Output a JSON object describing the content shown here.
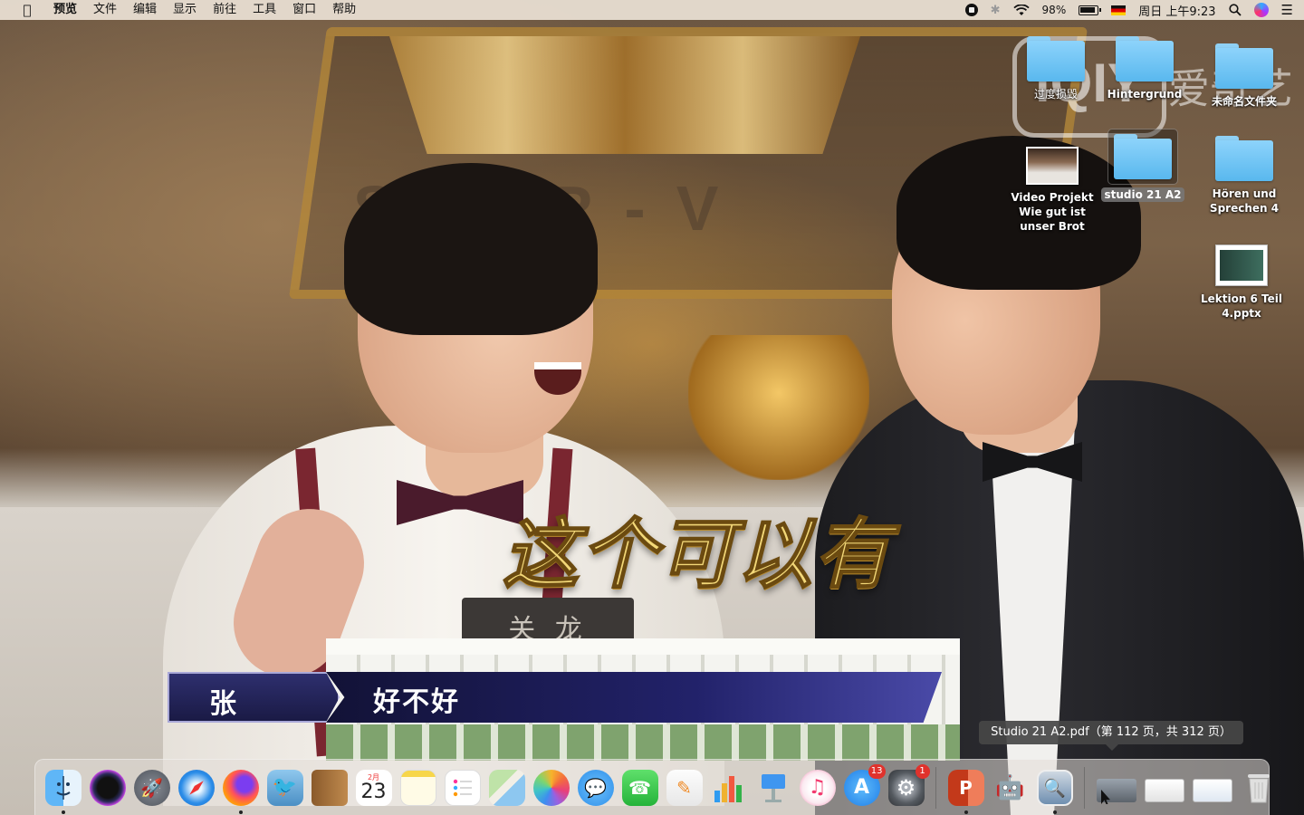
{
  "menubar": {
    "apple_icon": "apple-logo-icon",
    "app_name": "预览",
    "menus": [
      "文件",
      "编辑",
      "显示",
      "前往",
      "工具",
      "窗口",
      "帮助"
    ],
    "battery_percent": "98%",
    "clock": "周日 上午9:23",
    "status_icons": [
      "screen-record-icon",
      "bluetooth-icon",
      "wifi-icon",
      "battery-icon",
      "input-source-flag-icon",
      "spotlight-search-icon",
      "siri-icon",
      "notification-center-icon"
    ]
  },
  "wallpaper": {
    "subtitle": "这个可以有",
    "lower_third_name": "张 超",
    "lower_third_text": "好不好",
    "watermark_logo": "iQIY",
    "watermark_text": "爱奇艺",
    "backdrop_text": "S ER-V",
    "nameplate": "关  龙"
  },
  "desktop": {
    "items": [
      {
        "label": "过度损毁",
        "kind": "folder"
      },
      {
        "label": "Hintergrund",
        "kind": "folder"
      },
      {
        "label": "未命名文件夹",
        "kind": "folder"
      },
      {
        "label": "Video Projekt Wie gut ist unser Brot",
        "kind": "video"
      },
      {
        "label": "studio 21 A2",
        "kind": "folder",
        "selected": true
      },
      {
        "label": "Hören und Sprechen 4",
        "kind": "folder"
      },
      {
        "label": "Lektion 6 Teil 4.pptx",
        "kind": "pptx"
      }
    ]
  },
  "tooltip": {
    "text": "Studio 21 A2.pdf（第 112 页，共 312 页）"
  },
  "dock": {
    "calendar_month": "2月",
    "calendar_day": "23",
    "app_store_badge": "13",
    "system_prefs_badge": "1",
    "apps": [
      "finder-icon",
      "siri-icon",
      "launchpad-icon",
      "safari-icon",
      "firefox-icon",
      "mail-icon",
      "contacts-icon",
      "calendar-icon",
      "notes-icon",
      "reminders-icon",
      "maps-icon",
      "photos-icon",
      "messages-icon",
      "facetime-icon",
      "pages-icon",
      "numbers-icon",
      "keynote-icon",
      "music-icon",
      "app-store-icon",
      "system-preferences-icon",
      "powerpoint-icon",
      "automator-icon",
      "preview-icon",
      "minimized-window-1",
      "minimized-window-2",
      "minimized-window-3",
      "trash-icon"
    ]
  }
}
